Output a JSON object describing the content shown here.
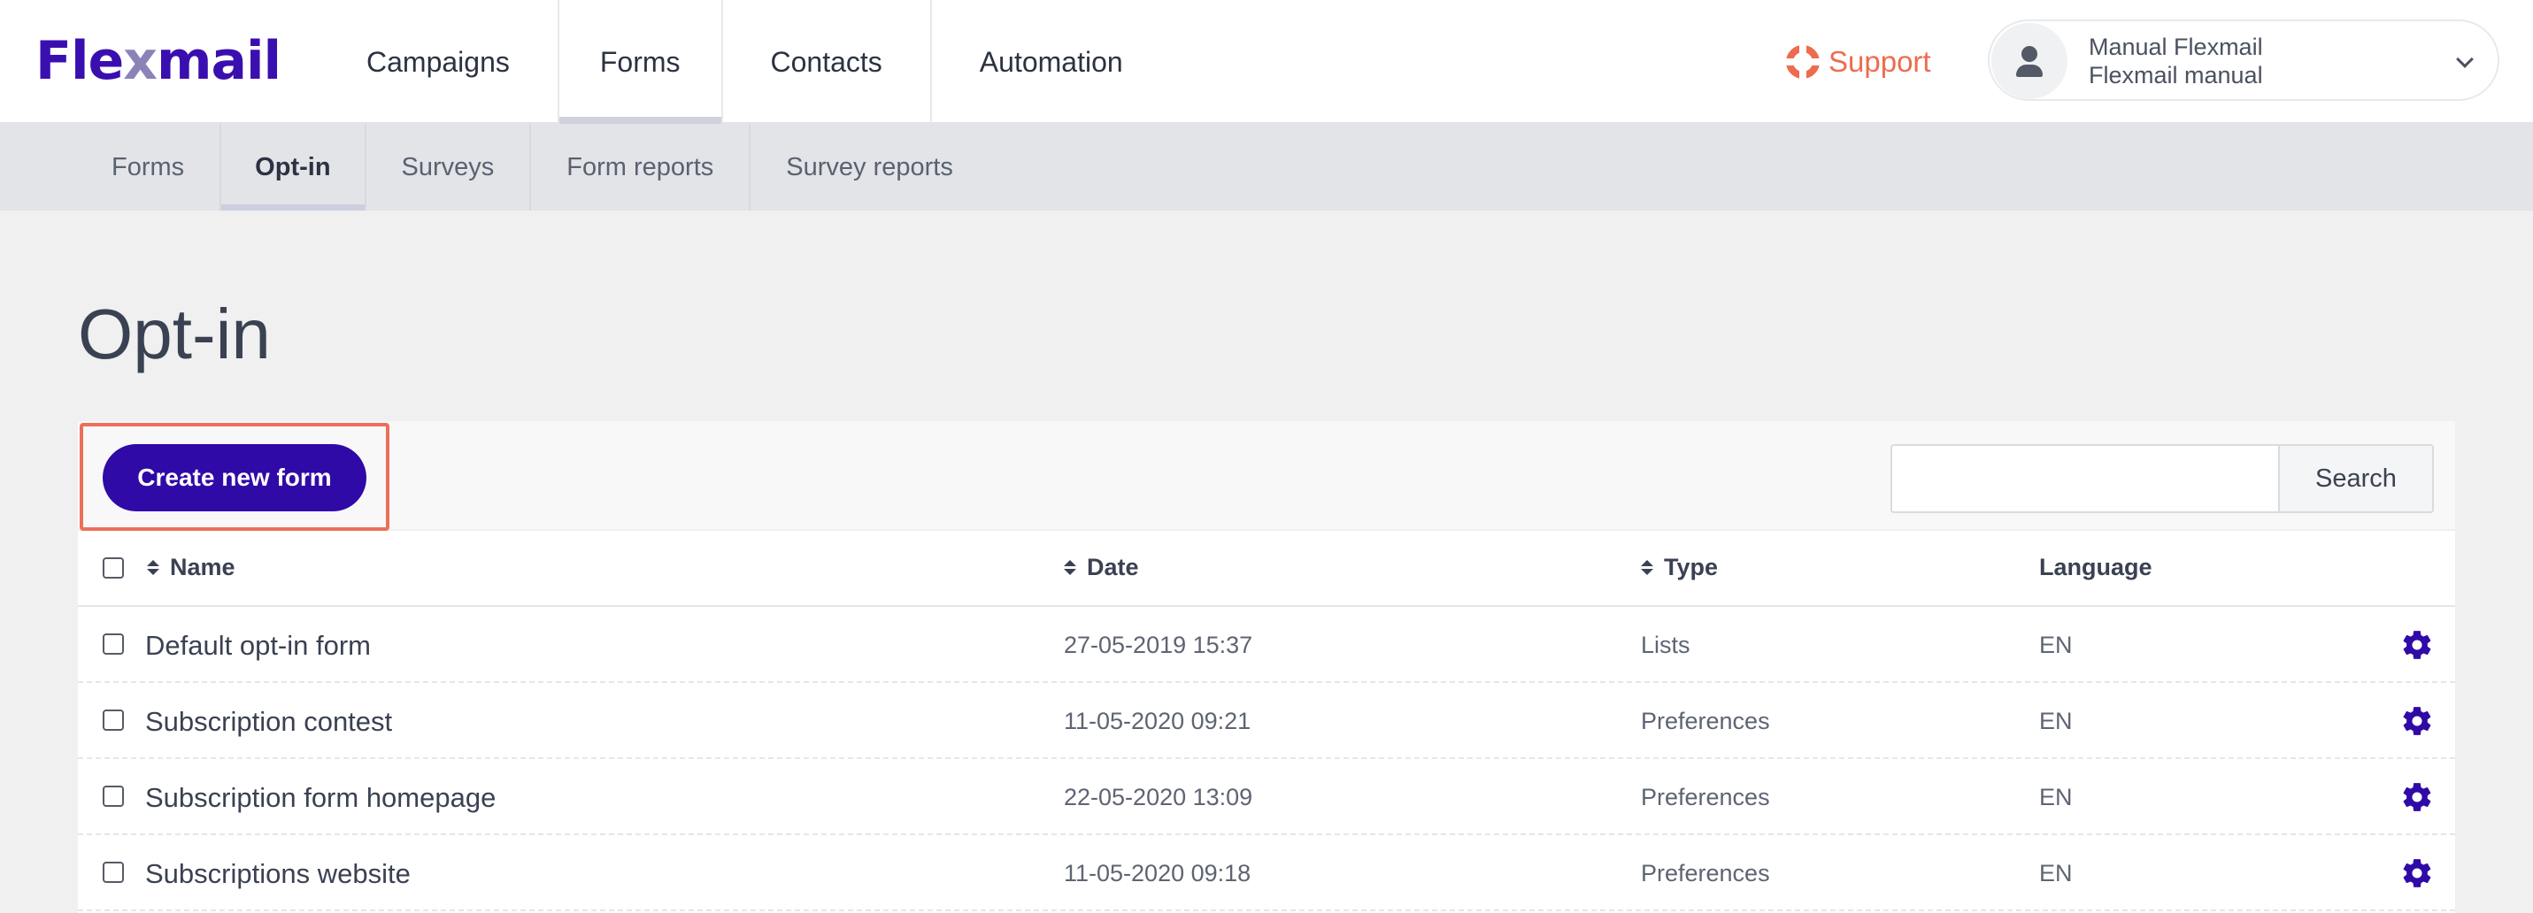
{
  "brand": {
    "logo_pre": "Fle",
    "logo_x": "x",
    "logo_post": "mail",
    "accent": "#300aa7",
    "support_color": "#ed6c4f"
  },
  "main_nav": {
    "items": [
      {
        "label": "Campaigns"
      },
      {
        "label": "Forms"
      },
      {
        "label": "Contacts"
      },
      {
        "label": "Automation"
      }
    ],
    "active": "Forms"
  },
  "support": {
    "label": "Support",
    "icon": "lifebuoy-icon"
  },
  "user": {
    "name": "Manual Flexmail",
    "account": "Flexmail manual",
    "icon": "user-icon"
  },
  "sub_nav": {
    "items": [
      {
        "label": "Forms"
      },
      {
        "label": "Opt-in"
      },
      {
        "label": "Surveys"
      },
      {
        "label": "Form reports"
      },
      {
        "label": "Survey reports"
      }
    ],
    "active": "Opt-in"
  },
  "page": {
    "title": "Opt-in"
  },
  "toolbar": {
    "create_label": "Create new form",
    "search_label": "Search",
    "search_value": ""
  },
  "table": {
    "columns": {
      "name": "Name",
      "date": "Date",
      "type": "Type",
      "language": "Language"
    },
    "rows": [
      {
        "name": "Default opt-in form",
        "date": "27-05-2019 15:37",
        "type": "Lists",
        "language": "EN"
      },
      {
        "name": "Subscription contest",
        "date": "11-05-2020 09:21",
        "type": "Preferences",
        "language": "EN"
      },
      {
        "name": "Subscription form homepage",
        "date": "22-05-2020 13:09",
        "type": "Preferences",
        "language": "EN"
      },
      {
        "name": "Subscriptions website",
        "date": "11-05-2020 09:18",
        "type": "Preferences",
        "language": "EN"
      }
    ]
  }
}
